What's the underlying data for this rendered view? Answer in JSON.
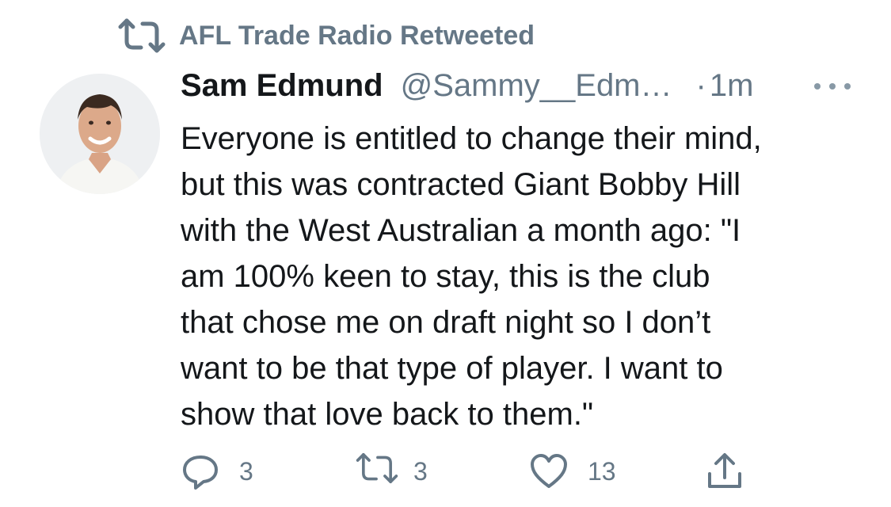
{
  "retweet_banner": {
    "label": "AFL Trade Radio Retweeted",
    "icon": "retweet-icon"
  },
  "author": {
    "display_name": "Sam Edmund",
    "handle": "@Sammy__Edm…",
    "separator": "·",
    "time": "1m"
  },
  "tweet": {
    "text": "Everyone is entitled to change their mind,\nbut this was contracted Giant Bobby Hill\nwith the West Australian a month ago: \"I\nam 100% keen to stay, this is the club\nthat chose me on draft night so I don’t\nwant to be that type of player. I want to\nshow that love back to them.\""
  },
  "actions": {
    "reply": {
      "icon": "reply-icon",
      "count": "3"
    },
    "retweet": {
      "icon": "retweet-icon",
      "count": "3"
    },
    "like": {
      "icon": "heart-icon",
      "count": "13"
    },
    "share": {
      "icon": "share-icon"
    }
  },
  "colors": {
    "primary_text": "#14171a",
    "secondary_text": "#657786",
    "background": "#ffffff"
  }
}
